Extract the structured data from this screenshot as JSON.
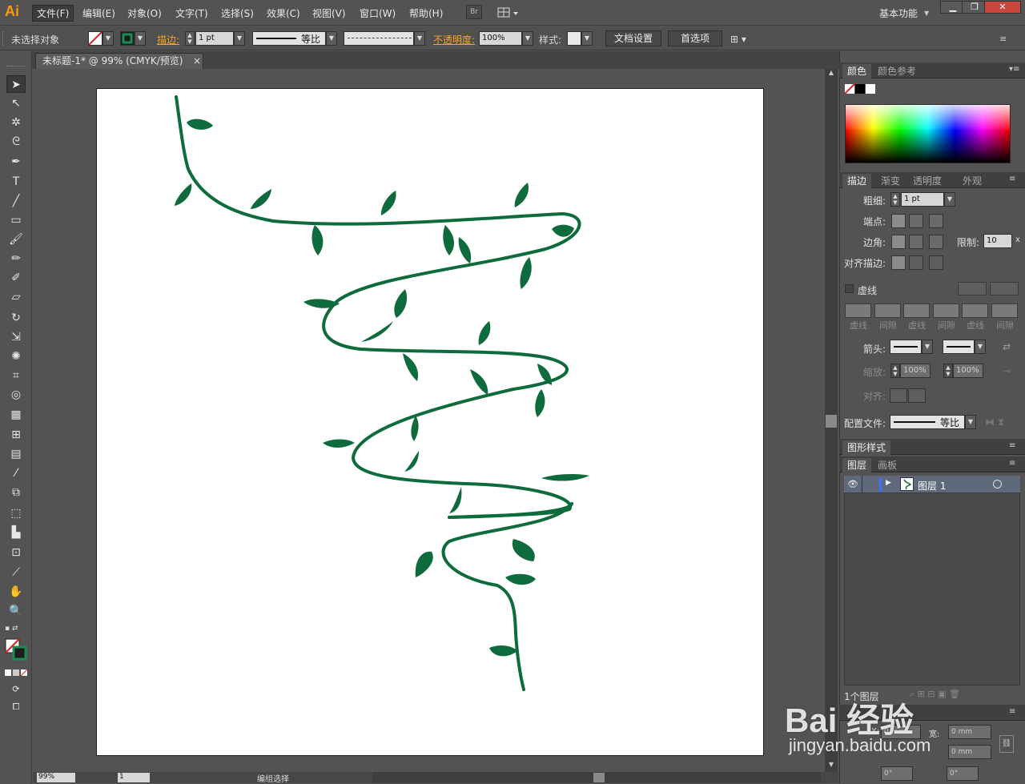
{
  "app": {
    "logo": "Ai",
    "workspace": "基本功能"
  },
  "menu": [
    "文件(F)",
    "编辑(E)",
    "对象(O)",
    "文字(T)",
    "选择(S)",
    "效果(C)",
    "视图(V)",
    "窗口(W)",
    "帮助(H)"
  ],
  "menubar_buttons": {
    "bridge": "Br"
  },
  "window_controls": {
    "minimize": "▁",
    "restore": "❐",
    "close": "✕"
  },
  "control_bar": {
    "selection_status": "未选择对象",
    "stroke_label": "描边:",
    "stroke_weight": "1 pt",
    "stroke_profile": "等比",
    "opacity_label": "不透明度:",
    "opacity_value": "100%",
    "style_label": "样式:",
    "doc_setup": "文档设置",
    "preferences": "首选项"
  },
  "document_tab": {
    "title": "未标题-1* @ 99% (CMYK/预览)",
    "close": "×"
  },
  "panels": {
    "color": {
      "tabs": [
        "颜色",
        "颜色参考"
      ]
    },
    "stroke": {
      "tabs": [
        "描边",
        "渐变",
        "透明度",
        "外观"
      ],
      "weight_label": "粗细:",
      "weight_value": "1 pt",
      "cap_label": "端点:",
      "corner_label": "边角:",
      "limit_label": "限制:",
      "limit_value": "10",
      "limit_unit": "x",
      "align_label": "对齐描边:",
      "dashed_label": "虚线",
      "dash_labels": [
        "虚线",
        "间隙",
        "虚线",
        "间隙",
        "虚线",
        "间隙"
      ],
      "arrow_label": "箭头:",
      "scale_label": "缩放:",
      "scale_start": "100%",
      "scale_end": "100%",
      "align_label2": "对齐:",
      "profile_label": "配置文件:",
      "profile_value": "等比"
    },
    "graphic_styles": {
      "tabs": [
        "图形样式"
      ]
    },
    "layers": {
      "tabs": [
        "图层",
        "画板"
      ],
      "layer_name": "图层 1",
      "layer_count": "1个图层"
    },
    "transform": {
      "x_label": "X:",
      "x_value": "0 mm",
      "w_label": "宽:",
      "w_value": "0 mm",
      "h_value": "0 mm",
      "angle1": "0°",
      "angle2": "0°"
    }
  },
  "status_bar": {
    "zoom": "99%",
    "page": "1",
    "status_text": "编组选择"
  },
  "watermark": {
    "brand": "Bai 经验",
    "url": "jingyan.baidu.com"
  },
  "colors": {
    "vine": "#0d6b3c",
    "ui_bg": "#535353",
    "accent_orange": "#f5a623"
  }
}
